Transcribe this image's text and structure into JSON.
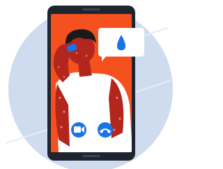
{
  "illustration": {
    "colors": {
      "background_circle": "#cfdcef",
      "phone_body": "#1e2530",
      "screen": "#f4511e",
      "skin": "#b3261e",
      "shirt": "#ffffff",
      "hair": "#1a1a1a",
      "icon_pad": "#1a73e8",
      "accent_blue": "#1a73e8",
      "bubble": "#ffffff",
      "droplet": "#1a73e8"
    },
    "icons": {
      "video": "video-camera-icon",
      "hangup": "phone-hangup-icon",
      "bubble": "water-drop-icon"
    }
  }
}
